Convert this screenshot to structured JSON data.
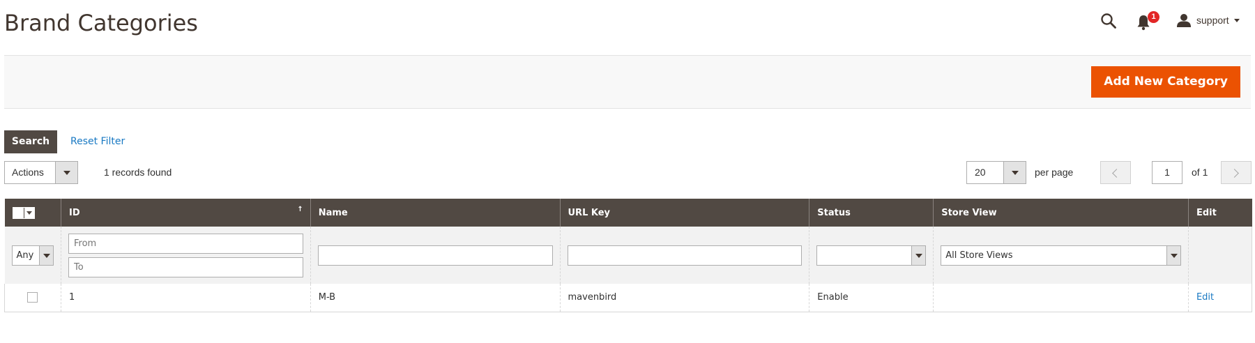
{
  "header": {
    "title": "Brand Categories",
    "notifications_count": "1",
    "user_name": "support"
  },
  "page_actions": {
    "add_button": "Add New Category"
  },
  "toolbar": {
    "search_label": "Search",
    "reset_label": "Reset Filter",
    "actions_label": "Actions",
    "records_found": "1 records found",
    "per_page_value": "20",
    "per_page_label": "per page",
    "current_page": "1",
    "page_of": "of 1"
  },
  "grid": {
    "columns": [
      "ID",
      "Name",
      "URL Key",
      "Status",
      "Store View",
      "Edit"
    ],
    "sort_indicator": "↑",
    "filters": {
      "mass_select_any": "Any",
      "id_from_placeholder": "From",
      "id_to_placeholder": "To",
      "name_value": "",
      "url_key_value": "",
      "status_value": "",
      "store_view_value": "All Store Views"
    },
    "rows": [
      {
        "id": "1",
        "name": "M-B",
        "url_key": "mavenbird",
        "status": "Enable",
        "store_view": "",
        "edit": "Edit"
      }
    ]
  },
  "colors": {
    "brand_orange": "#eb5202",
    "header_dark": "#514943",
    "link_blue": "#1979c3",
    "badge_red": "#e22626"
  },
  "icons": [
    "search-icon",
    "bell-icon",
    "user-icon",
    "chevron-left-icon",
    "chevron-right-icon"
  ]
}
